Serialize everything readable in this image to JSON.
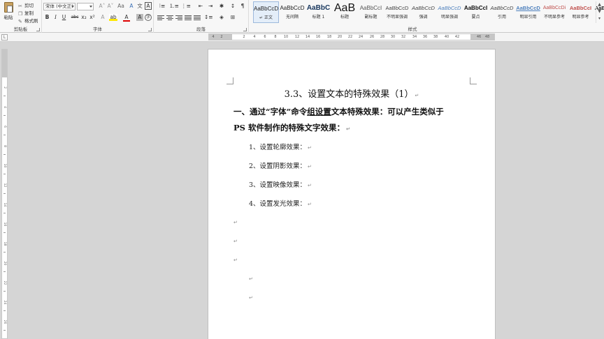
{
  "clipboard": {
    "paste_label": "粘贴",
    "cut_label": "剪切",
    "copy_label": "复制",
    "format_painter_label": "格式刷",
    "group_label": "剪贴板"
  },
  "font": {
    "font_name": "宋体 (中文正)",
    "font_size": "",
    "group_label": "字体",
    "bold": "B",
    "italic": "I",
    "underline": "U",
    "strikethrough": "abc",
    "subscript": "x₂",
    "superscript": "x²",
    "grow_font": "A˄",
    "shrink_font": "A˅",
    "change_case": "Aa",
    "clear_format": "A",
    "phonetic": "文",
    "char_border": "A",
    "highlight": "ab",
    "font_color": "A",
    "char_shading": "A",
    "enclose": "字"
  },
  "paragraph": {
    "group_label": "段落"
  },
  "styles": {
    "group_label": "样式",
    "items": [
      {
        "sample": "AaBbCcD",
        "name": "↵ 正文"
      },
      {
        "sample": "AaBbCcD",
        "name": "无间隔"
      },
      {
        "sample": "AaBbC",
        "name": "标题 1"
      },
      {
        "sample": "AaB",
        "name": "标题"
      },
      {
        "sample": "AaBbCcI",
        "name": "副标题"
      },
      {
        "sample": "AaBbCcD",
        "name": "不明显强调"
      },
      {
        "sample": "AaBbCcD",
        "name": "强调"
      },
      {
        "sample": "AaBbCcD",
        "name": "明显强调"
      },
      {
        "sample": "AaBbCcI",
        "name": "要点"
      },
      {
        "sample": "AaBbCcD",
        "name": "引用"
      },
      {
        "sample": "AaBbCcD",
        "name": "明显引用"
      },
      {
        "sample": "AaBbCcDi",
        "name": "不明显参考"
      },
      {
        "sample": "AaBbCcI",
        "name": "明显参考"
      },
      {
        "sample": "AaBbCcD",
        "name": "书"
      }
    ]
  },
  "ruler": {
    "numbers": [
      "4",
      "2",
      "2",
      "4",
      "6",
      "8",
      "10",
      "12",
      "14",
      "16",
      "18",
      "20",
      "22",
      "24",
      "26",
      "28",
      "30",
      "32",
      "34",
      "36",
      "38",
      "40",
      "42",
      "46",
      "48"
    ],
    "vertical_numbers": [
      "2",
      "4",
      "6",
      "8",
      "10",
      "12",
      "14",
      "16",
      "18",
      "20",
      "22",
      "24",
      "26",
      "28"
    ]
  },
  "document": {
    "title": "3.3、设置文本的特殊效果（1）",
    "heading_line1_a": "一、通过“字体”命令",
    "heading_line1_u": "组设置",
    "heading_line1_b": "文本特殊效果：可以产生类似于",
    "heading_line2": "PS 软件制作的特殊文字效果：",
    "items": [
      "1、设置轮廓效果：",
      "2、设置阴影效果：",
      "3、设置映像效果：",
      "4、设置发光效果："
    ],
    "paragraph_mark": "↵"
  }
}
